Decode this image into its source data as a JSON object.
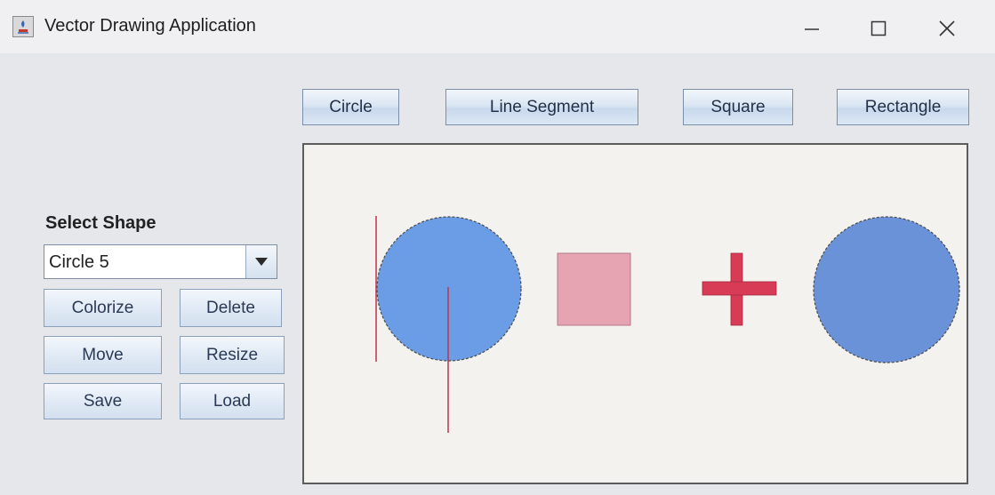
{
  "window": {
    "title": "Vector Drawing Application",
    "controls": {
      "minimize_icon": "minimize-icon",
      "maximize_icon": "maximize-icon",
      "close_icon": "close-icon"
    }
  },
  "toolbar": {
    "buttons": [
      {
        "label": "Circle"
      },
      {
        "label": "Line Segment"
      },
      {
        "label": "Square"
      },
      {
        "label": "Rectangle"
      }
    ]
  },
  "sidebar": {
    "select_label": "Select Shape",
    "selected_shape": "Circle 5",
    "buttons": [
      {
        "label": "Colorize"
      },
      {
        "label": "Delete"
      },
      {
        "label": "Move"
      },
      {
        "label": "Resize"
      },
      {
        "label": "Save"
      },
      {
        "label": "Load"
      }
    ]
  },
  "colors": {
    "circle_fill": "#6a9de6",
    "circle_stroke": "#4a4a4a",
    "square_fill": "#e6a3b1",
    "plus_fill": "#d83b55",
    "line_color": "#c2334d",
    "button_text": "#23314a"
  },
  "canvas": {
    "shapes": [
      "circle",
      "line-segment",
      "line-segment",
      "square",
      "plus",
      "circle"
    ]
  }
}
